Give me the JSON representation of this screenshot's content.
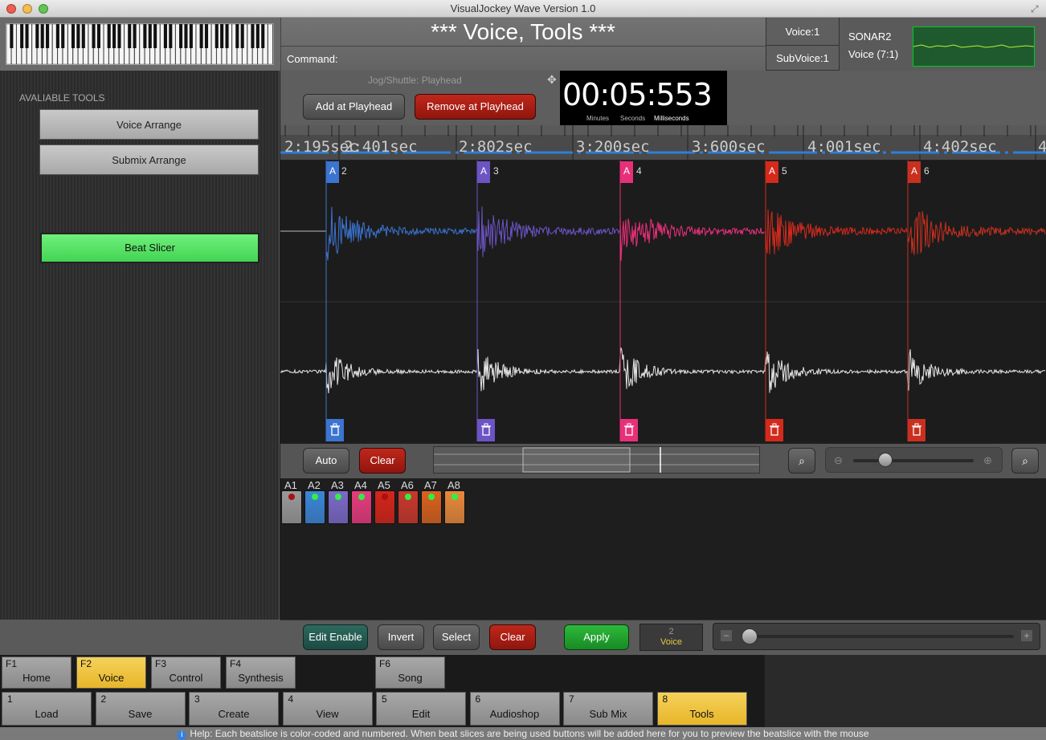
{
  "window": {
    "title": "VisualJockey Wave Version 1.0"
  },
  "header": {
    "title": "*** Voice, Tools ***",
    "command_label": "Command:",
    "voice": "Voice:1",
    "subvoice": "SubVoice:1",
    "device_name": "SONAR2",
    "device_voice": "Voice (7:1)"
  },
  "left_panel": {
    "label": "AVALIABLE TOOLS",
    "tools": [
      "Voice Arrange",
      "Submix Arrange"
    ],
    "active_tool": "Beat Slicer"
  },
  "toolbar": {
    "jog_label": "Jog/Shuttle: Playhead",
    "add_label": "Add at Playhead",
    "remove_label": "Remove at Playhead"
  },
  "time": {
    "value": "00:05:553",
    "minutes": "Minutes",
    "seconds": "Seconds",
    "milliseconds": "Milliseconds"
  },
  "ruler": {
    "ticks": [
      "2:195sec",
      "2:401sec",
      "2:802sec",
      "3:200sec",
      "3:600sec",
      "4:001sec",
      "4:402sec",
      "4"
    ]
  },
  "markers": [
    {
      "flag": "A",
      "num": "2",
      "color": "#3b74d1"
    },
    {
      "flag": "A",
      "num": "3",
      "color": "#6c54c4"
    },
    {
      "flag": "A",
      "num": "4",
      "color": "#e8307a"
    },
    {
      "flag": "A",
      "num": "5",
      "color": "#d42a1c"
    },
    {
      "flag": "A",
      "num": "6",
      "color": "#c9301f"
    }
  ],
  "wave_controls": {
    "auto_label": "Auto",
    "clear_label": "Clear"
  },
  "slices": [
    {
      "label": "A1",
      "color": "#9a9a9a",
      "led": "#aa1111"
    },
    {
      "label": "A2",
      "color": "#3b86d8",
      "led": "#33ee44"
    },
    {
      "label": "A3",
      "color": "#7b6ac8",
      "led": "#33ee44"
    },
    {
      "label": "A4",
      "color": "#e63c7e",
      "led": "#33ee44"
    },
    {
      "label": "A5",
      "color": "#d5251a",
      "led": "#aa1111"
    },
    {
      "label": "A6",
      "color": "#c9382c",
      "led": "#33ee44"
    },
    {
      "label": "A7",
      "color": "#d9621f",
      "led": "#33ee44"
    },
    {
      "label": "A8",
      "color": "#e8893b",
      "led": "#33ee44"
    }
  ],
  "edit_bar": {
    "edit_enable": "Edit Enable",
    "invert": "Invert",
    "select": "Select",
    "clear": "Clear",
    "apply": "Apply",
    "voice_num": "2",
    "voice_label": "Voice"
  },
  "fkeys": [
    {
      "num": "F1",
      "label": "Home",
      "active": false
    },
    {
      "num": "F2",
      "label": "Voice",
      "active": true
    },
    {
      "num": "F3",
      "label": "Control",
      "active": false
    },
    {
      "num": "F4",
      "label": "Synthesis",
      "active": false
    },
    {
      "num": "F6",
      "label": "Song",
      "active": false
    }
  ],
  "numkeys": [
    {
      "num": "1",
      "label": "Load",
      "active": false
    },
    {
      "num": "2",
      "label": "Save",
      "active": false
    },
    {
      "num": "3",
      "label": "Create",
      "active": false
    },
    {
      "num": "4",
      "label": "View",
      "active": false
    },
    {
      "num": "5",
      "label": "Edit",
      "active": false
    },
    {
      "num": "6",
      "label": "Audioshop",
      "active": false
    },
    {
      "num": "7",
      "label": "Sub Mix",
      "active": false
    },
    {
      "num": "8",
      "label": "Tools",
      "active": true
    }
  ],
  "help": {
    "text": "Help: Each beatslice is color-coded and numbered. When beat slices are being used buttons will be added here for you to preview the beatslice with the mouse"
  }
}
